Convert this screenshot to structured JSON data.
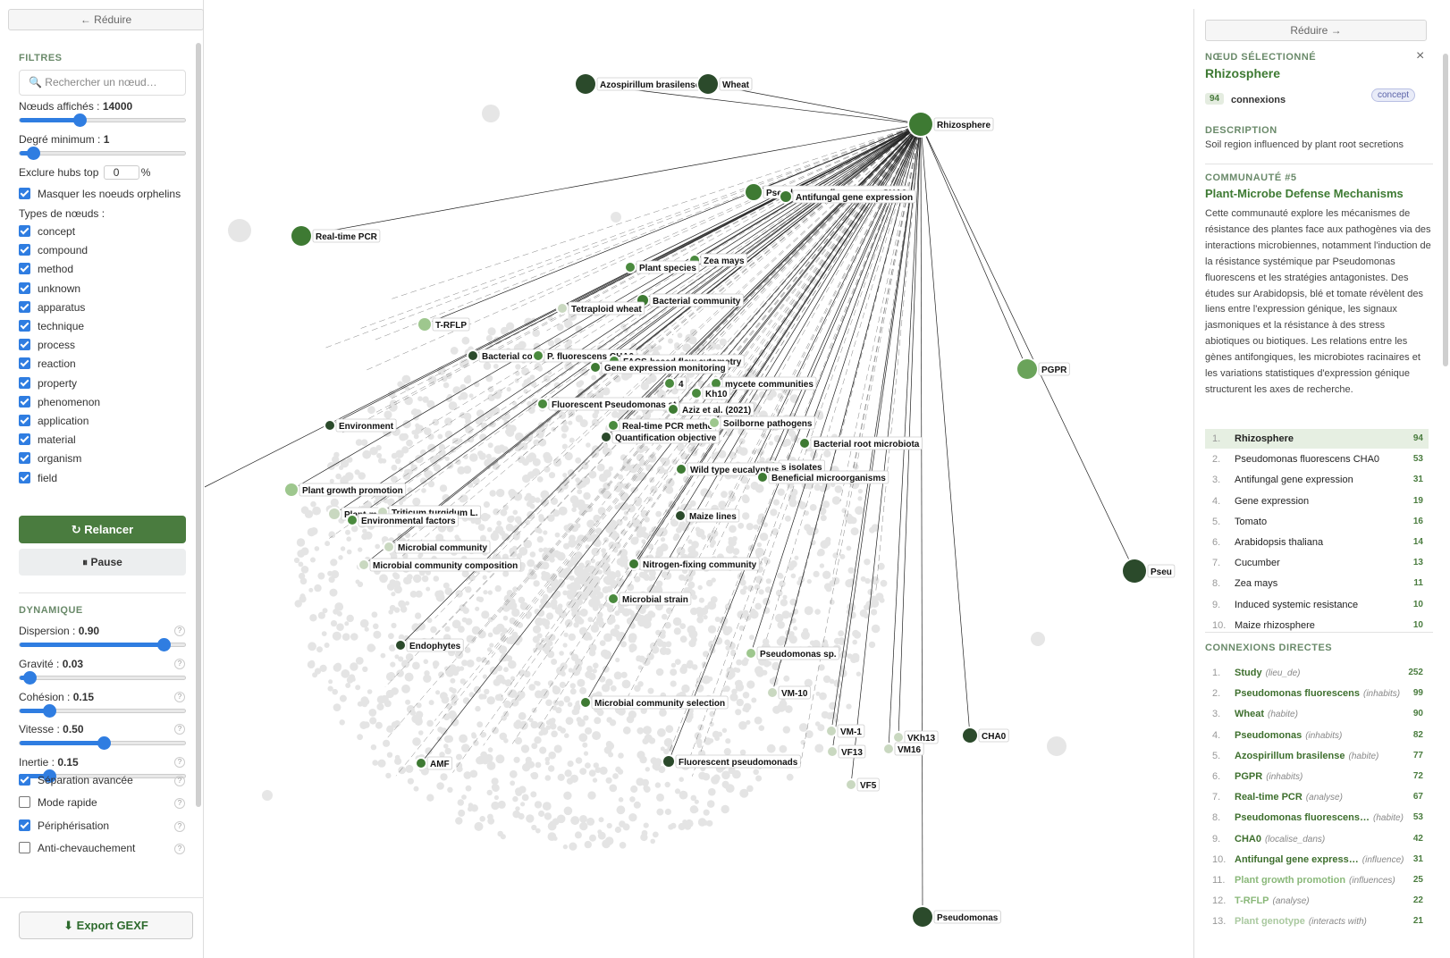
{
  "left": {
    "collapse_label": "← Réduire",
    "filters_title": "FILTRES",
    "search_placeholder": "🔍 Rechercher un nœud…",
    "nodes_shown_label": "Nœuds affichés : ",
    "nodes_shown_value": "14000",
    "nodes_shown_fraction": 0.36,
    "min_degree_label": "Degré minimum : ",
    "min_degree_value": "1",
    "min_degree_fraction": 0.08,
    "exclude_hubs_label": "Exclure hubs top",
    "exclude_hubs_value": "0",
    "exclude_hubs_unit": "%",
    "hide_orphans_label": "Masquer les noeuds orphelins",
    "node_types_title": "Types de nœuds :",
    "node_types": [
      "concept",
      "compound",
      "method",
      "unknown",
      "apparatus",
      "technique",
      "process",
      "reaction",
      "property",
      "phenomenon",
      "application",
      "material",
      "organism",
      "field"
    ],
    "restart_label": "↻ Relancer",
    "pause_label": "⏸ Pause",
    "dynamics_title": "DYNAMIQUE",
    "sliders": [
      {
        "label": "Dispersion : ",
        "value": "0.90",
        "fraction": 0.87
      },
      {
        "label": "Gravité : ",
        "value": "0.03",
        "fraction": 0.06
      },
      {
        "label": "Cohésion : ",
        "value": "0.15",
        "fraction": 0.18
      },
      {
        "label": "Vitesse : ",
        "value": "0.50",
        "fraction": 0.51
      },
      {
        "label": "Inertie : ",
        "value": "0.15",
        "fraction": 0.18
      }
    ],
    "options": [
      {
        "label": "Séparation avancée",
        "checked": true
      },
      {
        "label": "Mode rapide",
        "checked": false
      },
      {
        "label": "Périphérisation",
        "checked": true
      },
      {
        "label": "Anti-chevauchement",
        "checked": false
      }
    ],
    "help_glyph": "?",
    "export_label": "⬇ Export GEXF"
  },
  "graph": {
    "hub": "Rhizosphere",
    "nodes": [
      {
        "label": "Azospirillum brasilense",
        "color": "#2b4a2b"
      },
      {
        "label": "Wheat",
        "color": "#2b4a2b"
      },
      {
        "label": "Rhizosphere",
        "color": "#3e7a33"
      },
      {
        "label": "Pseudomonas fluorescens CHA0",
        "color": "#3e7a33"
      },
      {
        "label": "Antifungal gene expression",
        "color": "#3e7a33"
      },
      {
        "label": "Real-time PCR",
        "color": "#3e7a33"
      },
      {
        "label": "Zea mays",
        "color": "#4a8a3e"
      },
      {
        "label": "Plant species",
        "color": "#4a8a3e"
      },
      {
        "label": "Bacterial community",
        "color": "#3e7a33"
      },
      {
        "label": "Tetraploid wheat",
        "color": "#c9d8c0"
      },
      {
        "label": "T-RFLP",
        "color": "#9ec78e"
      },
      {
        "label": "PGPR",
        "color": "#6aa35a"
      },
      {
        "label": "Bacterial com",
        "color": "#2b4a2b"
      },
      {
        "label": "P. fluorescens CHA0",
        "color": "#4a8a3e"
      },
      {
        "label": "FACS-based flow cytometry",
        "color": "#4a8a3e"
      },
      {
        "label": "Gene expression monitoring",
        "color": "#3e7a33"
      },
      {
        "label": "4",
        "color": "#4a8a3e"
      },
      {
        "label": "mycete communities",
        "color": "#4a8a3e"
      },
      {
        "label": "Kh10",
        "color": "#4a8a3e"
      },
      {
        "label": "Fluorescent Pseudomonas st",
        "color": "#4a8a3e"
      },
      {
        "label": "Aziz et al. (2021)",
        "color": "#3e7a33"
      },
      {
        "label": "Environment",
        "color": "#2b4a2b"
      },
      {
        "label": "Real-time PCR metho",
        "color": "#4a8a3e"
      },
      {
        "label": "Soilborne pathogens",
        "color": "#9ec78e"
      },
      {
        "label": "Quantification objective",
        "color": "#2b4a2b"
      },
      {
        "label": "Bacterial root microbiota",
        "color": "#3e7a33"
      },
      {
        "label": "s isolates",
        "color": "#4a8a3e"
      },
      {
        "label": "13",
        "color": "#4a8a3e"
      },
      {
        "label": "Wild type eucalyptus",
        "color": "#3e7a33"
      },
      {
        "label": "Beneficial microorganisms",
        "color": "#3e7a33"
      },
      {
        "label": "Plant growth promotion",
        "color": "#9ec78e"
      },
      {
        "label": "Plant-mic",
        "color": "#c9d8c0"
      },
      {
        "label": "Triticum turgidum L.",
        "color": "#c9d8c0"
      },
      {
        "label": "Environmental factors",
        "color": "#4a8a3e"
      },
      {
        "label": "Maize lines",
        "color": "#2b4a2b"
      },
      {
        "label": "Pseu",
        "color": "#2b4a2b"
      },
      {
        "label": "Microbial community",
        "color": "#c9d8c0"
      },
      {
        "label": "Microbial community composition",
        "color": "#c9d8c0"
      },
      {
        "label": "Nitrogen-fixing community",
        "color": "#3e7a33"
      },
      {
        "label": "Microbial strain",
        "color": "#4a8a3e"
      },
      {
        "label": "Endophytes",
        "color": "#2b4a2b"
      },
      {
        "label": "Pseudomonas sp.",
        "color": "#9ec78e"
      },
      {
        "label": "VM-10",
        "color": "#c9d8c0"
      },
      {
        "label": "Microbial community selection",
        "color": "#3e7a33"
      },
      {
        "label": "VM-1",
        "color": "#c9d8c0"
      },
      {
        "label": "VKh13",
        "color": "#c9d8c0"
      },
      {
        "label": "CHA0",
        "color": "#2b4a2b"
      },
      {
        "label": "VF13",
        "color": "#c9d8c0"
      },
      {
        "label": "VM16",
        "color": "#c9d8c0"
      },
      {
        "label": "AMF",
        "color": "#3e7a33"
      },
      {
        "label": "Fluorescent pseudomonads",
        "color": "#2b4a2b"
      },
      {
        "label": "VF5",
        "color": "#c9d8c0"
      },
      {
        "label": "Pseudomonas",
        "color": "#2b4a2b"
      }
    ]
  },
  "right": {
    "collapse_label": "Réduire →",
    "selected_title": "NŒUD SÉLECTIONNÉ",
    "close_glyph": "×",
    "node_name": "Rhizosphere",
    "degree": "94",
    "degree_label": "connexions",
    "type_badge": "concept",
    "description_title": "DESCRIPTION",
    "description": "Soil region influenced by plant root secretions",
    "community_title": "COMMUNAUTÉ #5",
    "community_name": "Plant-Microbe Defense Mechanisms",
    "community_text": "Cette communauté explore les mécanismes de résistance des plantes face aux pathogènes via des interactions microbiennes, notamment l'induction de la résistance systémique par Pseudomonas fluorescens et les stratégies antagonistes. Des études sur Arabidopsis, blé et tomate révèlent des liens entre l'expression génique, les signaux jasmoniques et la résistance à des stress abiotiques ou biotiques. Les relations entre les gènes antifongiques, les microbiotes racinaires et les variations statistiques d'expression génique structurent les axes de recherche.",
    "ranking": [
      {
        "n": "1.",
        "name": "Rhizosphere",
        "count": "94"
      },
      {
        "n": "2.",
        "name": "Pseudomonas fluorescens CHA0",
        "count": "53"
      },
      {
        "n": "3.",
        "name": "Antifungal gene expression",
        "count": "31"
      },
      {
        "n": "4.",
        "name": "Gene expression",
        "count": "19"
      },
      {
        "n": "5.",
        "name": "Tomato",
        "count": "16"
      },
      {
        "n": "6.",
        "name": "Arabidopsis thaliana",
        "count": "14"
      },
      {
        "n": "7.",
        "name": "Cucumber",
        "count": "13"
      },
      {
        "n": "8.",
        "name": "Zea mays",
        "count": "11"
      },
      {
        "n": "9.",
        "name": "Induced systemic resistance",
        "count": "10"
      },
      {
        "n": "10.",
        "name": "Maize rhizosphere",
        "count": "10"
      }
    ],
    "connections_title": "CONNEXIONS DIRECTES",
    "connections": [
      {
        "n": "1.",
        "name": "Study",
        "rel": "(lieu_de)",
        "count": "252"
      },
      {
        "n": "2.",
        "name": "Pseudomonas fluorescens",
        "rel": "(inhabits)",
        "count": "99"
      },
      {
        "n": "3.",
        "name": "Wheat",
        "rel": "(habite)",
        "count": "90"
      },
      {
        "n": "4.",
        "name": "Pseudomonas",
        "rel": "(inhabits)",
        "count": "82"
      },
      {
        "n": "5.",
        "name": "Azospirillum brasilense",
        "rel": "(habite)",
        "count": "77"
      },
      {
        "n": "6.",
        "name": "PGPR",
        "rel": "(inhabits)",
        "count": "72"
      },
      {
        "n": "7.",
        "name": "Real-time PCR",
        "rel": "(analyse)",
        "count": "67"
      },
      {
        "n": "8.",
        "name": "Pseudomonas fluorescens…",
        "rel": "(habite)",
        "count": "53"
      },
      {
        "n": "9.",
        "name": "CHA0",
        "rel": "(localise_dans)",
        "count": "42"
      },
      {
        "n": "10.",
        "name": "Antifungal gene express…",
        "rel": "(influence)",
        "count": "31"
      },
      {
        "n": "11.",
        "name": "Plant growth promotion",
        "rel": "(influences)",
        "count": "25"
      },
      {
        "n": "12.",
        "name": "T-RFLP",
        "rel": "(analyse)",
        "count": "22"
      },
      {
        "n": "13.",
        "name": "Plant genotype",
        "rel": "(interacts with)",
        "count": "21"
      }
    ]
  }
}
